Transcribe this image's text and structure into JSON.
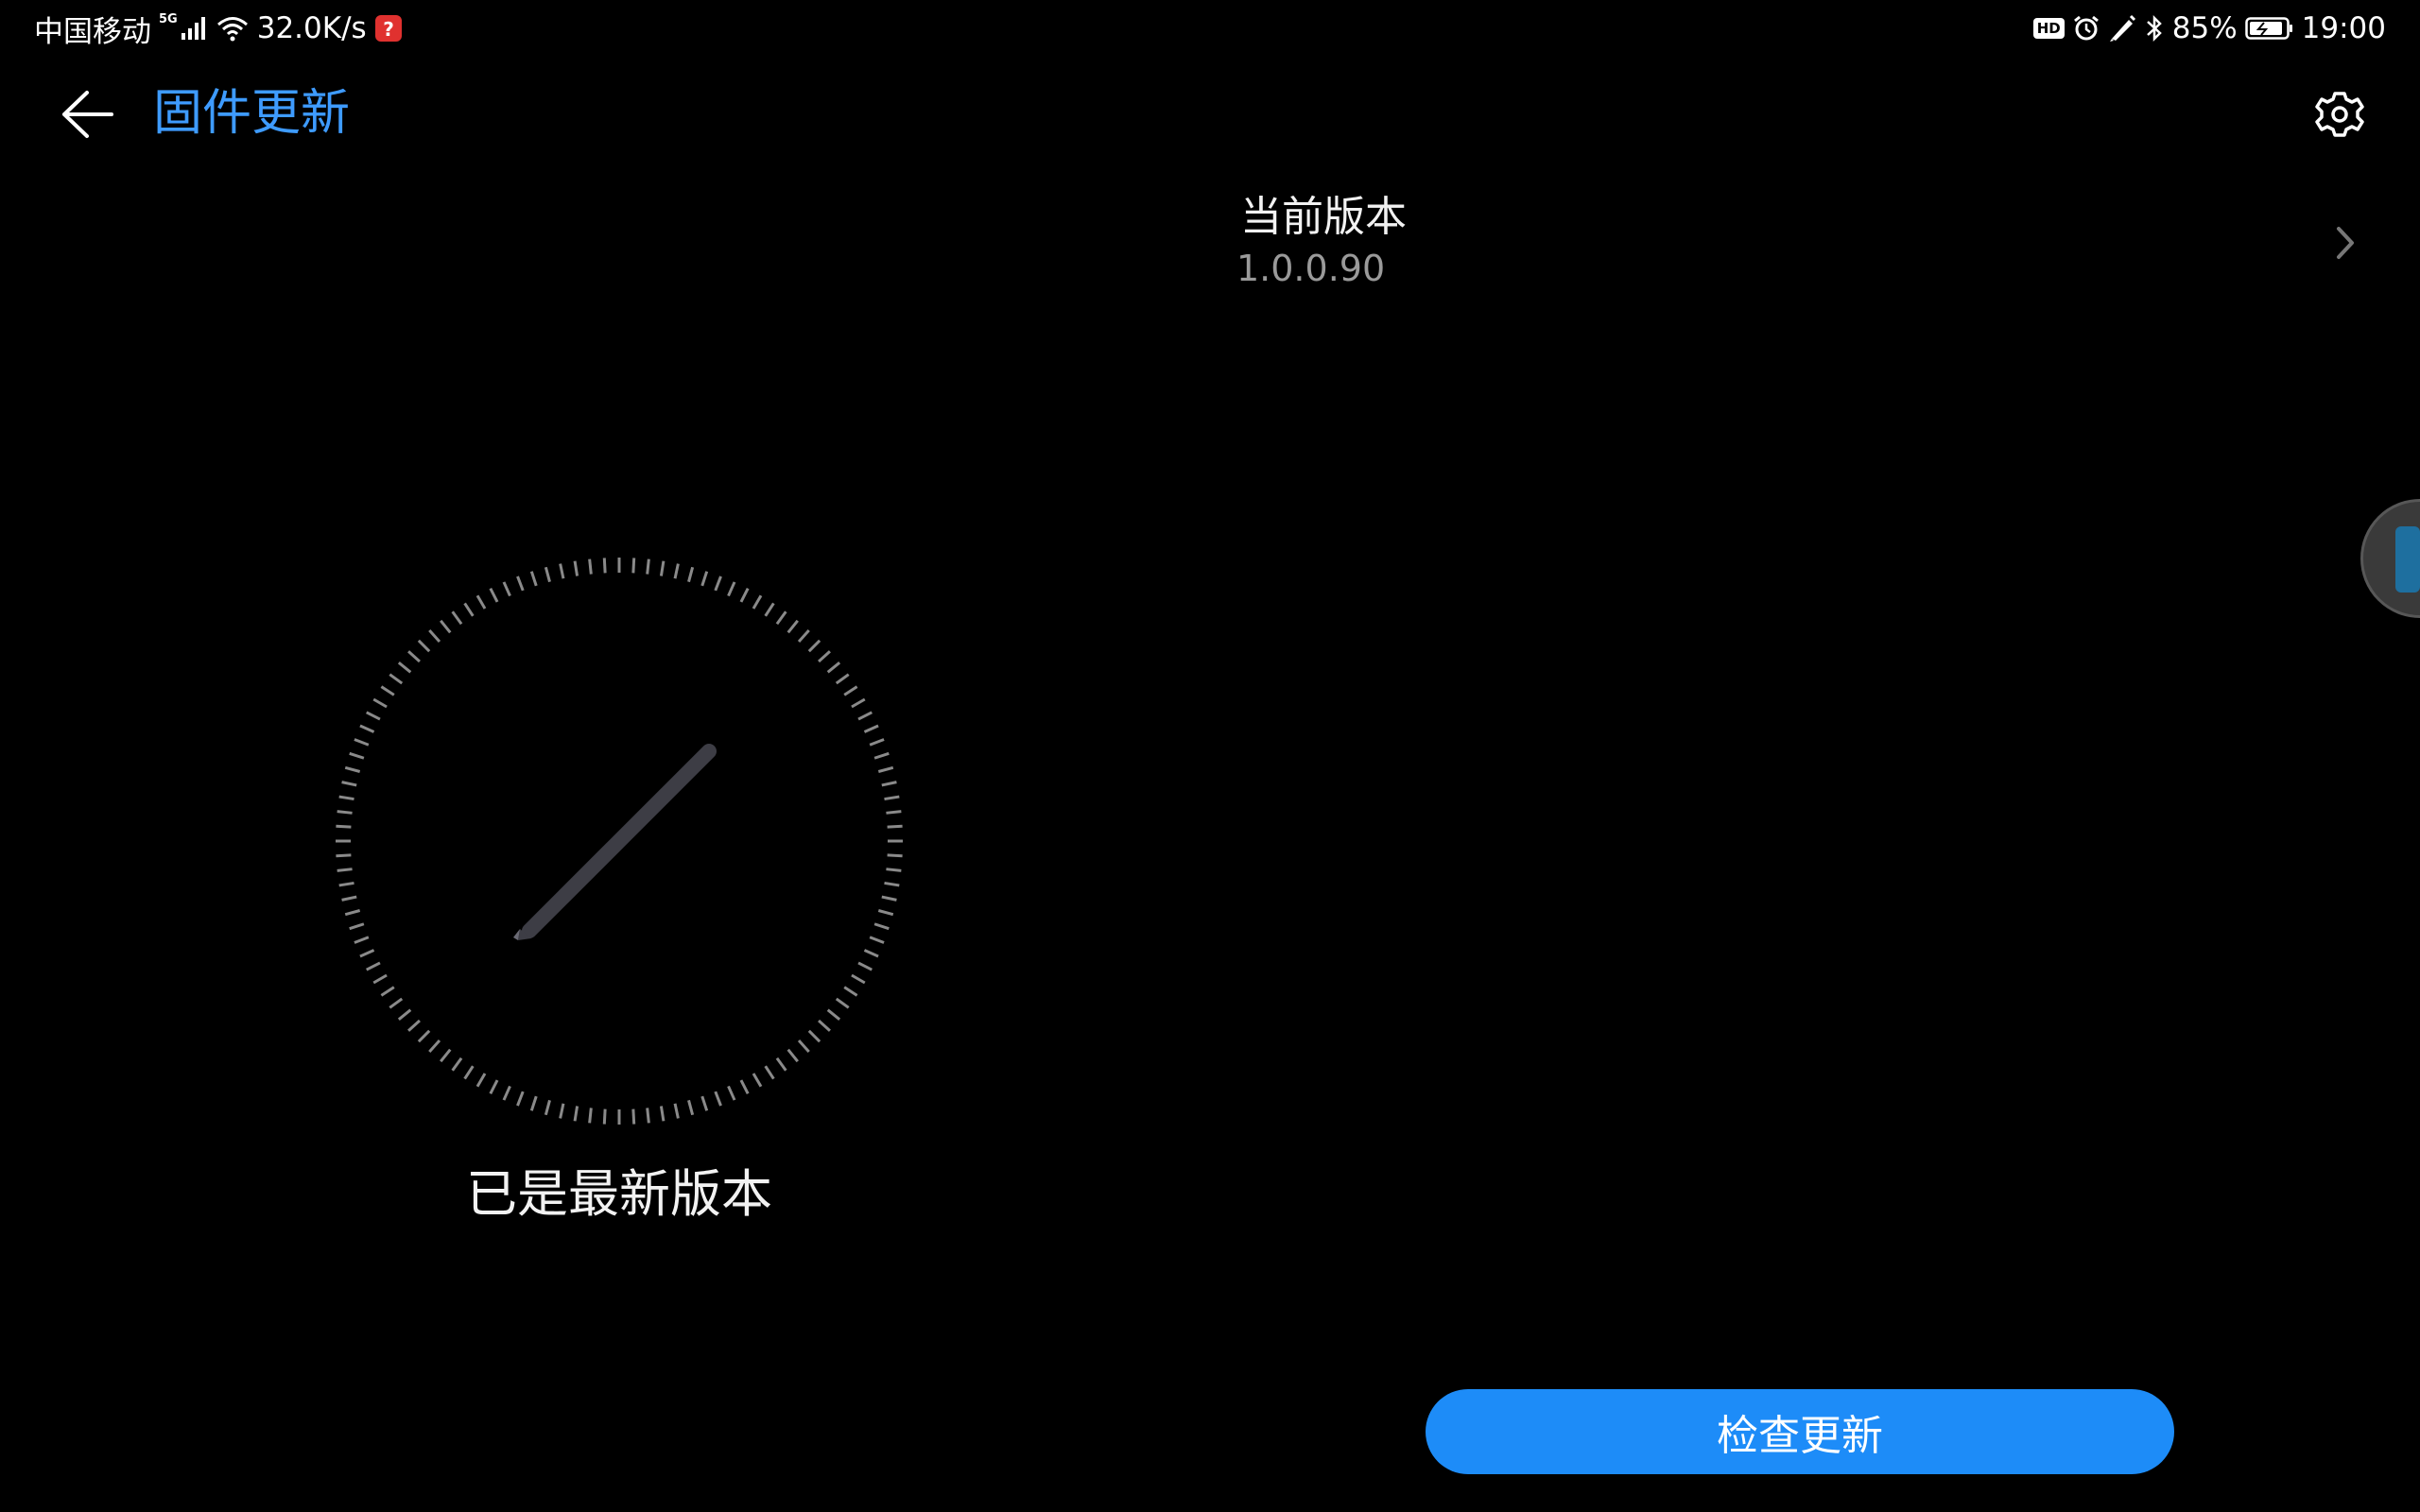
{
  "status_bar": {
    "carrier": "中国移动",
    "network_gen": "5G",
    "speed": "32.0K/s",
    "hd_badge": "HD",
    "battery": "85%",
    "time": "19:00"
  },
  "app_bar": {
    "title": "固件更新",
    "back_icon": "back-arrow-icon",
    "settings_icon": "gear-icon"
  },
  "version": {
    "label": "当前版本",
    "value": "1.0.0.90"
  },
  "status": {
    "message": "已是最新版本",
    "illustration_icon": "stylus-pen-icon"
  },
  "actions": {
    "check_update_label": "检查更新"
  },
  "colors": {
    "accent": "#3e9bff",
    "button": "#1d8cf8",
    "background": "#000000"
  }
}
